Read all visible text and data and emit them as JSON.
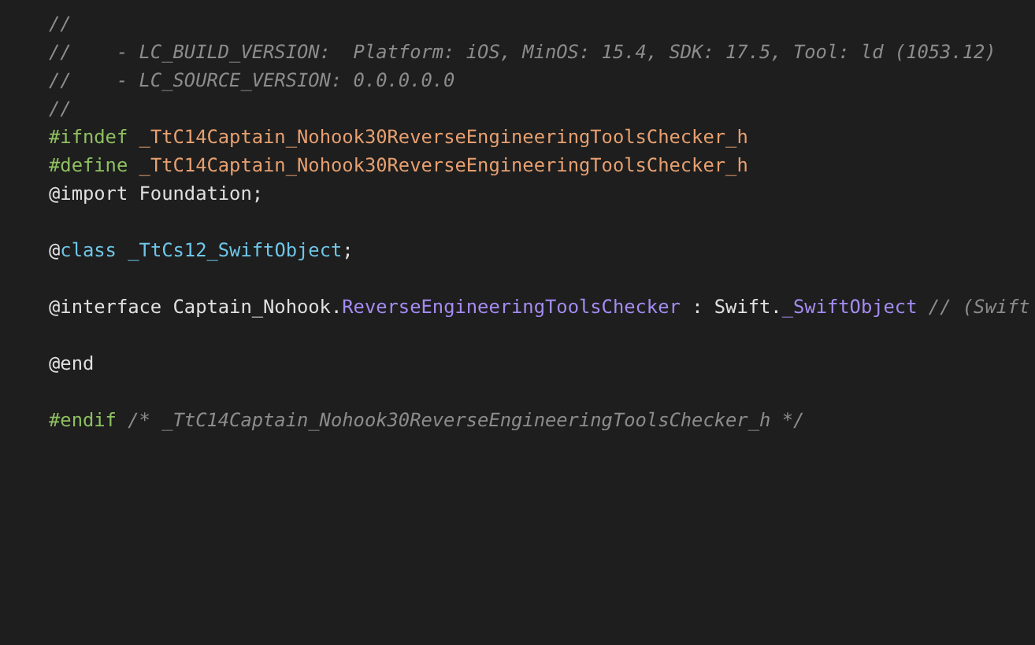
{
  "editor": {
    "lines": [
      {
        "kind": "code",
        "tokens": [
          {
            "kind": "comment",
            "text": "//"
          }
        ]
      },
      {
        "kind": "code",
        "tokens": [
          {
            "kind": "comment",
            "text": "//    - LC_BUILD_VERSION:  Platform: iOS, MinOS: 15.4, SDK: 17.5, Tool: ld (1053.12)"
          }
        ]
      },
      {
        "kind": "code",
        "tokens": [
          {
            "kind": "comment",
            "text": "//    - LC_SOURCE_VERSION: 0.0.0.0.0"
          }
        ]
      },
      {
        "kind": "code",
        "tokens": [
          {
            "kind": "comment",
            "text": "//"
          }
        ]
      },
      {
        "kind": "code",
        "tokens": [
          {
            "kind": "directive",
            "text": "#ifndef "
          },
          {
            "kind": "macro",
            "text": "_TtC14Captain_Nohook30ReverseEngineeringToolsChecker_h"
          }
        ]
      },
      {
        "kind": "code",
        "tokens": [
          {
            "kind": "directive",
            "text": "#define "
          },
          {
            "kind": "macro",
            "text": "_TtC14Captain_Nohook30ReverseEngineeringToolsChecker_h"
          }
        ]
      },
      {
        "kind": "code",
        "tokens": [
          {
            "kind": "plain",
            "text": "@import Foundation;"
          }
        ]
      },
      {
        "kind": "blank"
      },
      {
        "kind": "code",
        "tokens": [
          {
            "kind": "plain",
            "text": "@"
          },
          {
            "kind": "type",
            "text": "class _TtCs12_SwiftObject"
          },
          {
            "kind": "plain",
            "text": ";"
          }
        ]
      },
      {
        "kind": "blank"
      },
      {
        "kind": "code",
        "tokens": [
          {
            "kind": "plain",
            "text": "@interface Captain_Nohook."
          },
          {
            "kind": "class",
            "text": "ReverseEngineeringToolsChecker"
          },
          {
            "kind": "plain",
            "text": " : Swift."
          },
          {
            "kind": "class",
            "text": "_SwiftObject"
          },
          {
            "kind": "comment",
            "text": " // (Swift"
          }
        ]
      },
      {
        "kind": "blank"
      },
      {
        "kind": "code",
        "tokens": [
          {
            "kind": "plain",
            "text": "@end"
          }
        ]
      },
      {
        "kind": "blank"
      },
      {
        "kind": "code",
        "tokens": [
          {
            "kind": "directive",
            "text": "#endif"
          },
          {
            "kind": "comment",
            "text": " /* _TtC14Captain_Nohook30ReverseEngineeringToolsChecker_h */"
          }
        ]
      },
      {
        "kind": "blank"
      }
    ]
  }
}
